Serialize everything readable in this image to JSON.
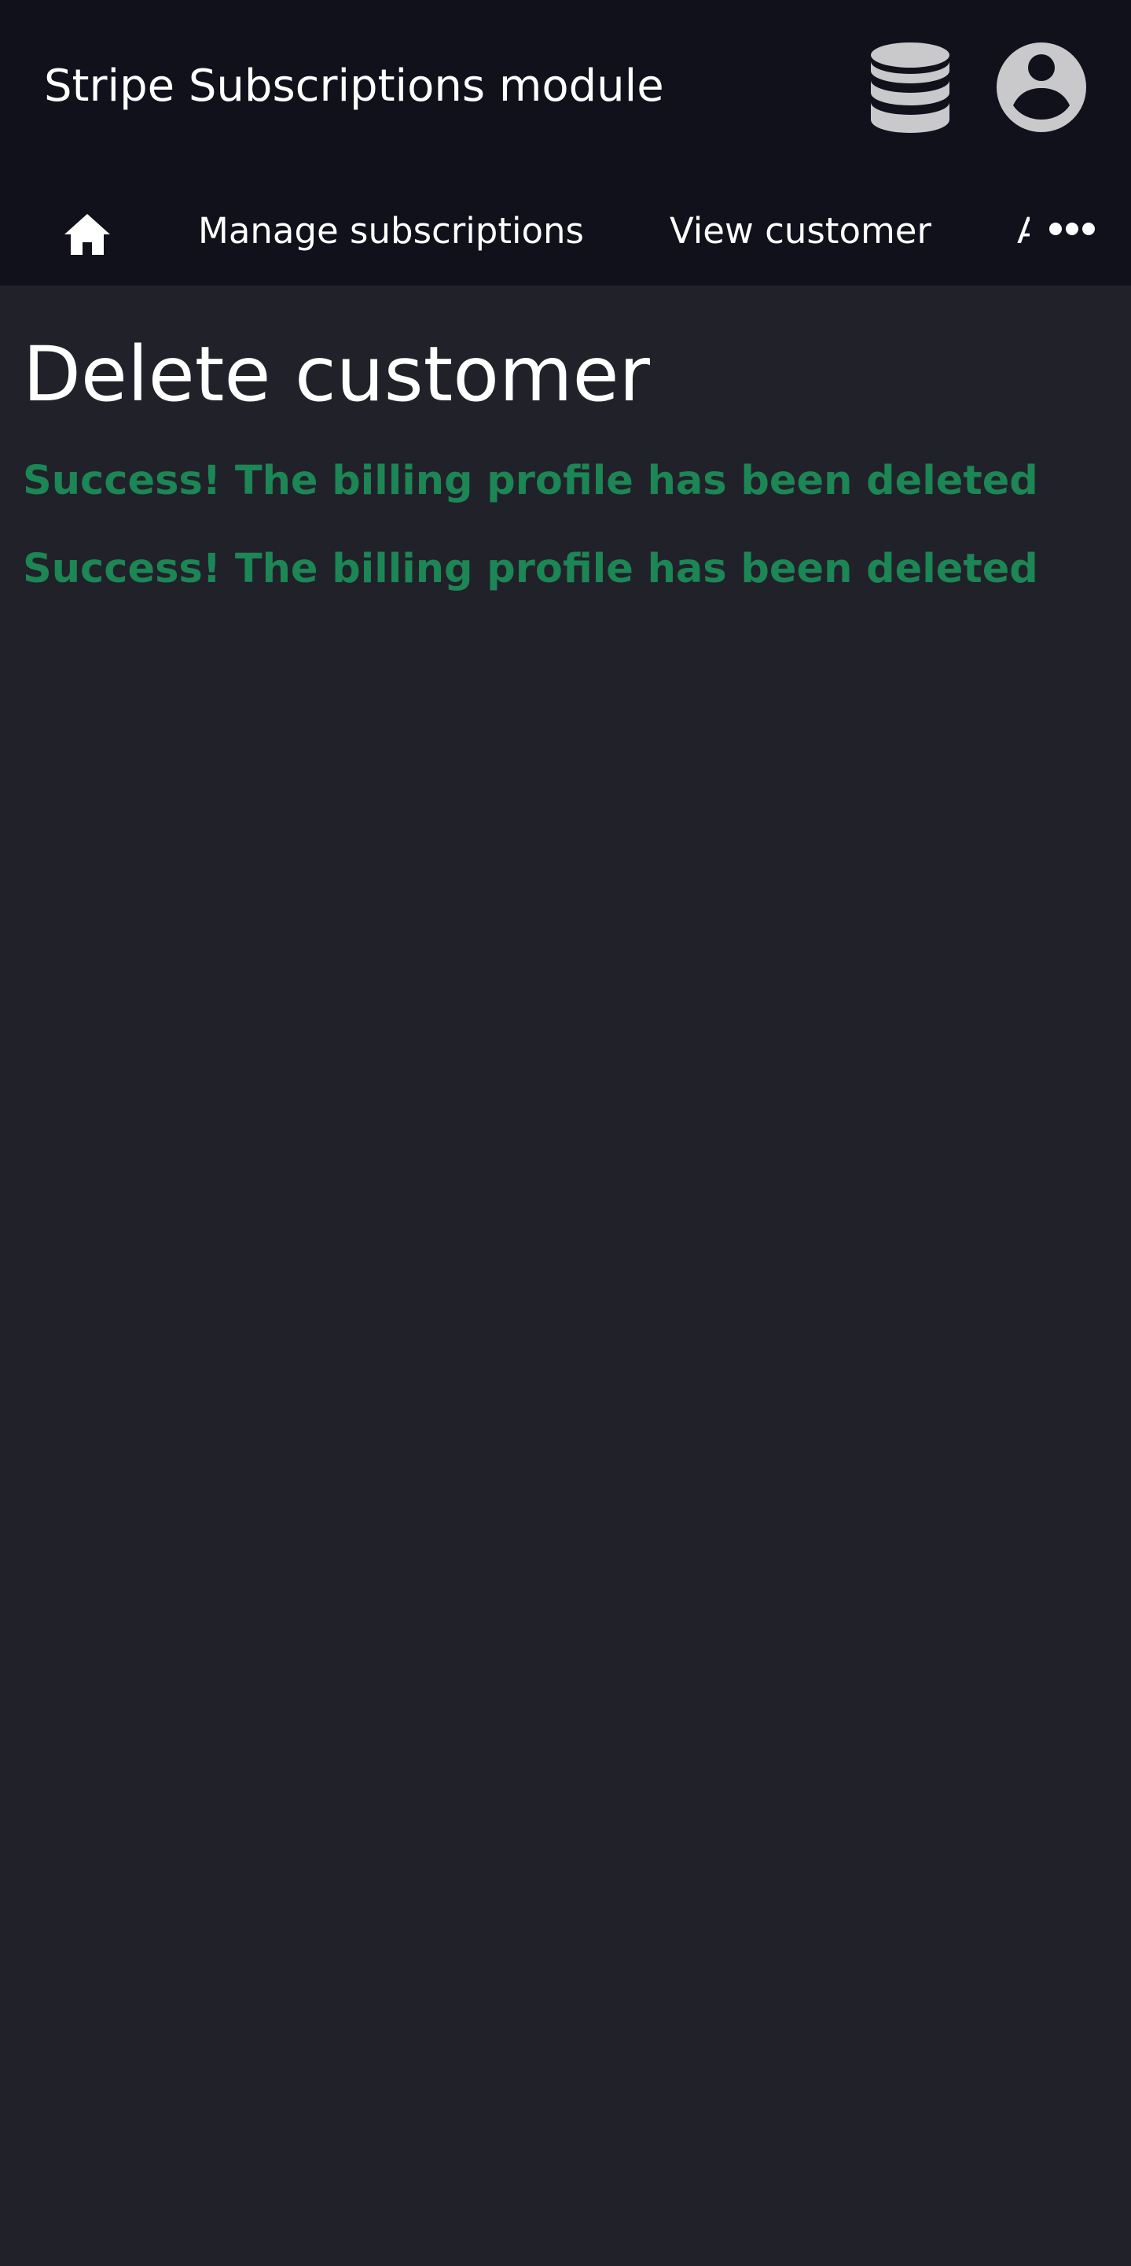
{
  "header": {
    "title": "Stripe Subscriptions module",
    "database_icon": "database-icon",
    "account_icon": "user-circle-icon"
  },
  "nav": {
    "home_icon": "home-icon",
    "items": [
      {
        "label": "Manage subscriptions"
      },
      {
        "label": "View customer"
      },
      {
        "label": "A"
      }
    ],
    "more_icon": "more-horizontal-icon"
  },
  "main": {
    "title": "Delete customer",
    "messages": [
      "Success! The billing profile has been deleted",
      "Success! The billing profile has been deleted"
    ]
  },
  "colors": {
    "header_bg": "#11111c",
    "page_bg": "#21212a",
    "success": "#1c8655",
    "icon_gray": "#c9c9cc"
  }
}
